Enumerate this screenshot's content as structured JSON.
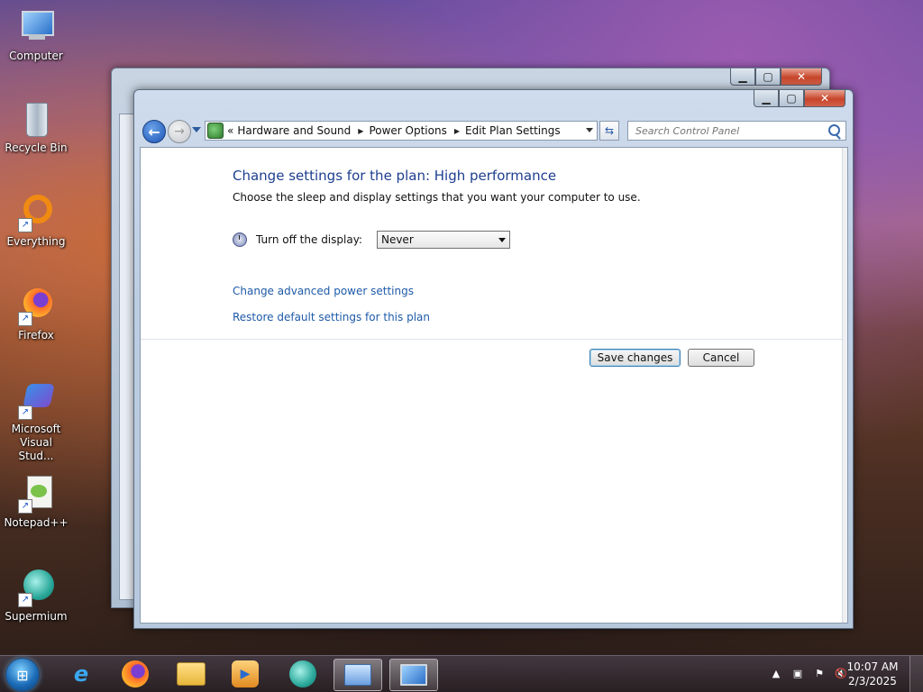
{
  "desktop": {
    "icons": [
      {
        "label": "Computer"
      },
      {
        "label": "Recycle Bin"
      },
      {
        "label": "Everything"
      },
      {
        "label": "Firefox"
      },
      {
        "label": "Microsoft Visual Stud..."
      },
      {
        "label": "Notepad++"
      },
      {
        "label": "Supermium"
      }
    ]
  },
  "window": {
    "breadcrumb": [
      "Hardware and Sound",
      "Power Options",
      "Edit Plan Settings"
    ],
    "breadcrumb_prefix": "«",
    "search_placeholder": "Search Control Panel",
    "heading": "Change settings for the plan: High performance",
    "subtext": "Choose the sleep and display settings that you want your computer to use.",
    "display_label": "Turn off the display:",
    "display_value": "Never",
    "link_advanced": "Change advanced power settings",
    "link_restore": "Restore default settings for this plan",
    "save_label": "Save changes",
    "cancel_label": "Cancel"
  },
  "taskbar": {
    "time": "10:07 AM",
    "date": "2/3/2025"
  },
  "colors": {
    "link": "#1e5aa8",
    "heading": "#1e3f8f"
  }
}
